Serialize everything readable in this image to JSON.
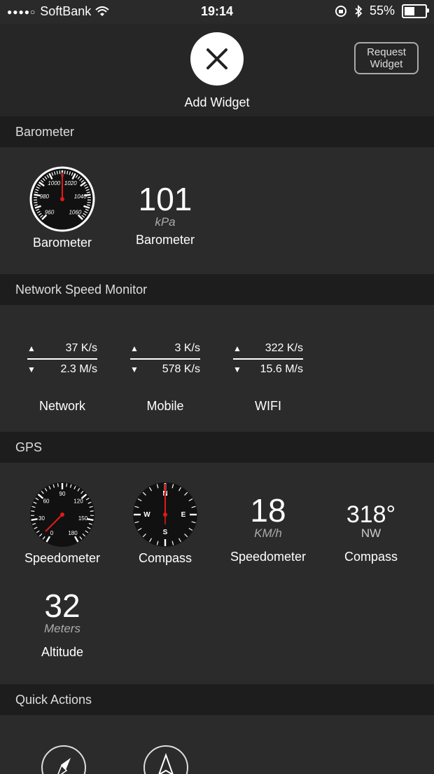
{
  "status_bar": {
    "carrier": "SoftBank",
    "time": "19:14",
    "battery": "55%"
  },
  "top": {
    "add_widget": "Add Widget",
    "request_widget": "Request\nWidget"
  },
  "sections": {
    "barometer": {
      "title": "Barometer",
      "gauge_label": "Barometer",
      "gauge_ticks": [
        "960",
        "980",
        "1000",
        "1020",
        "1040",
        "1060"
      ],
      "value": "101",
      "unit": "kPa",
      "value_label": "Barometer"
    },
    "network": {
      "title": "Network Speed Monitor",
      "items": [
        {
          "up": "37 K/s",
          "down": "2.3 M/s",
          "label": "Network"
        },
        {
          "up": "3 K/s",
          "down": "578 K/s",
          "label": "Mobile"
        },
        {
          "up": "322 K/s",
          "down": "15.6 M/s",
          "label": "WIFI"
        }
      ]
    },
    "gps": {
      "title": "GPS",
      "speedometer_gauge_label": "Speedometer",
      "speedometer_ticks": [
        "0",
        "30",
        "60",
        "90",
        "120",
        "150",
        "180"
      ],
      "compass_gauge_label": "Compass",
      "compass_letters": [
        "N",
        "E",
        "S",
        "W"
      ],
      "speed_value": "18",
      "speed_unit": "KM/h",
      "speed_label": "Speedometer",
      "heading_value": "318°",
      "heading_dir": "NW",
      "heading_label": "Compass",
      "altitude_value": "32",
      "altitude_unit": "Meters",
      "altitude_label": "Altitude"
    },
    "quick_actions": {
      "title": "Quick Actions"
    }
  }
}
